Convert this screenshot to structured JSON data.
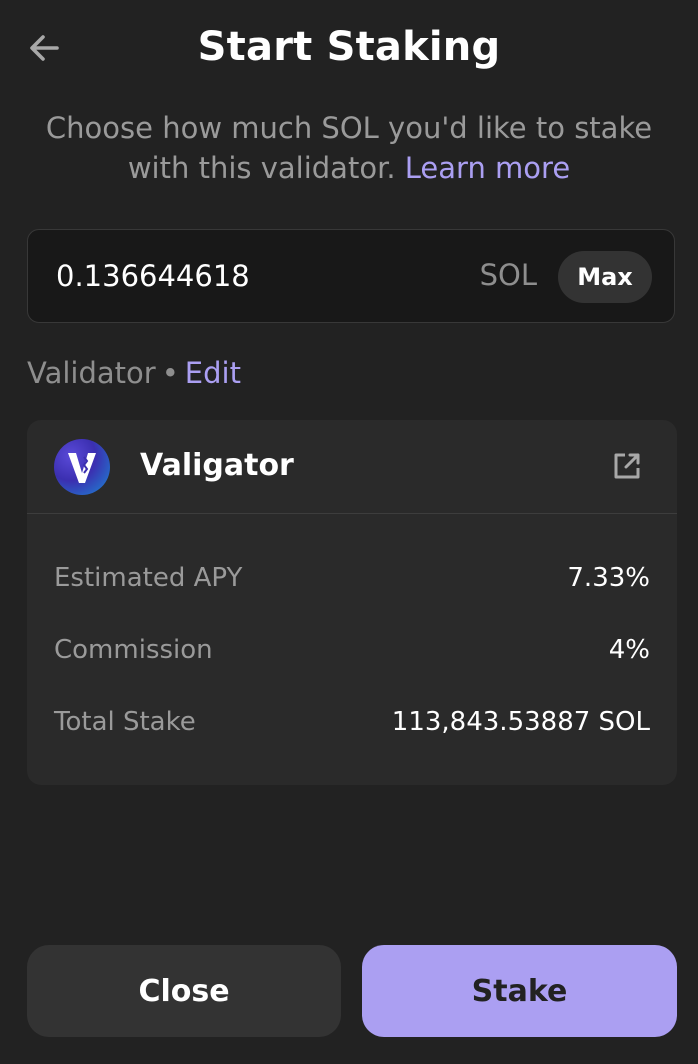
{
  "header": {
    "title": "Start Staking",
    "back_icon": "arrow-left-icon"
  },
  "intro": {
    "text": "Choose how much SOL you'd like to stake with this validator.",
    "learn_more": "Learn more"
  },
  "amount": {
    "value": "0.136644618",
    "unit": "SOL",
    "max_label": "Max"
  },
  "validator_section": {
    "label": "Validator",
    "separator": "•",
    "edit_label": "Edit"
  },
  "validator": {
    "name": "Valigator",
    "logo_icon": "valigator-logo-icon",
    "link_icon": "external-link-icon",
    "stats": [
      {
        "label": "Estimated APY",
        "value": "7.33%"
      },
      {
        "label": "Commission",
        "value": "4%"
      },
      {
        "label": "Total Stake",
        "value": "113,843.53887 SOL"
      }
    ]
  },
  "actions": {
    "close_label": "Close",
    "stake_label": "Stake"
  },
  "colors": {
    "background": "#222222",
    "card": "#2a2a2a",
    "accent": "#ab9ff2",
    "muted_text": "#9a9a9a"
  }
}
